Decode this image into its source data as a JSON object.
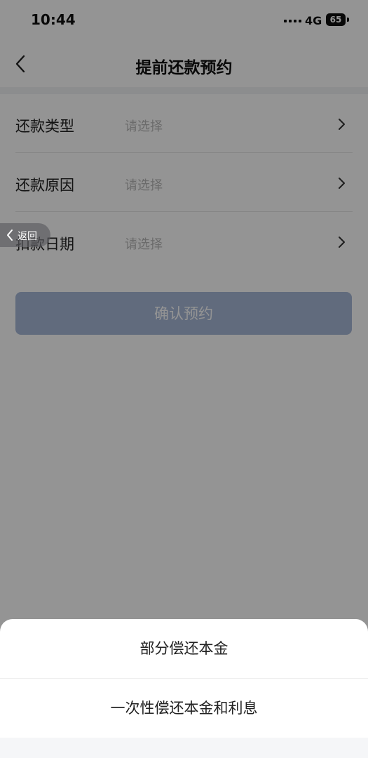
{
  "status_bar": {
    "time": "10:44",
    "network": "4G",
    "battery": "65"
  },
  "nav": {
    "title": "提前还款预约"
  },
  "form": {
    "rows": [
      {
        "label": "还款类型",
        "placeholder": "请选择"
      },
      {
        "label": "还款原因",
        "placeholder": "请选择"
      },
      {
        "label": "扣款日期",
        "placeholder": "请选择"
      }
    ]
  },
  "confirm_button": {
    "label": "确认预约"
  },
  "float_back": {
    "label": "返回"
  },
  "sheet": {
    "options": [
      {
        "label": "部分偿还本金"
      },
      {
        "label": "一次性偿还本金和利息"
      }
    ]
  },
  "colors": {
    "button_disabled": "#a8b9d8",
    "placeholder": "#b8b8b8",
    "mask": "rgba(0,0,0,0.42)"
  }
}
